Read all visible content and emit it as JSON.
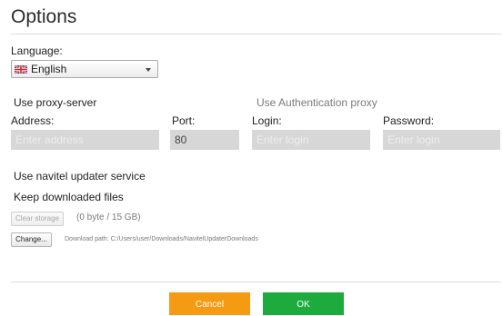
{
  "page": {
    "title": "Options"
  },
  "language": {
    "label": "Language:",
    "selected": "English",
    "flag_icon": "uk-flag-icon",
    "dropdown_icon": "chevron-down-icon"
  },
  "proxy": {
    "use_proxy_label": "Use proxy-server",
    "auth_label": "Use Authentication proxy",
    "address_label": "Address:",
    "address_placeholder": "Enter address",
    "address_value": "",
    "port_label": "Port:",
    "port_value": "80",
    "login_label": "Login:",
    "login_placeholder": "Enter login",
    "login_value": "",
    "password_label": "Password:",
    "password_placeholder": "Enter login",
    "password_value": ""
  },
  "updater": {
    "service_label": "Use navitel updater service",
    "keep_label": "Keep downloaded files",
    "clear_label": "Clear storage",
    "storage_info": "(0 byte / 15 GB)",
    "change_label": "Change...",
    "download_path": "Download path: C:/Users/user/Downloads/NavitelUpdaterDownloads"
  },
  "footer": {
    "cancel_label": "Cancel",
    "ok_label": "OK"
  },
  "colors": {
    "cancel": "#f59a13",
    "ok": "#1cab3c",
    "input_bg": "#d7d7d7"
  }
}
